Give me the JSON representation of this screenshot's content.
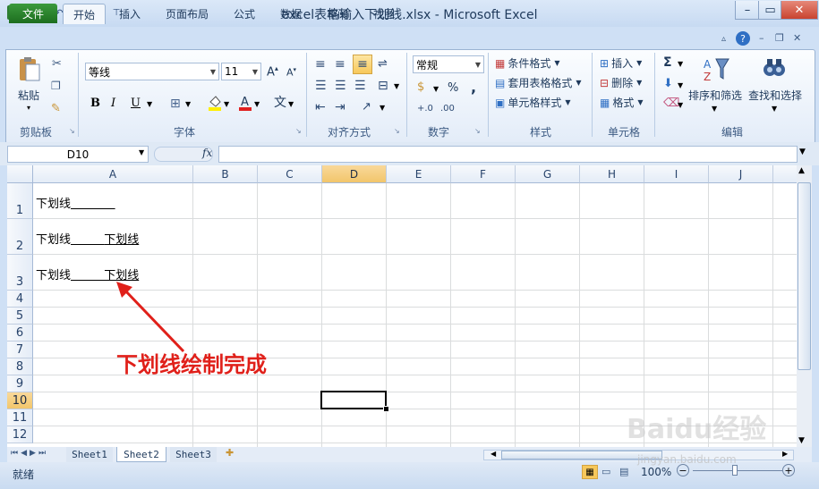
{
  "window": {
    "title": "excel表格输入下划线.xlsx - Microsoft Excel"
  },
  "tabs": [
    "文件",
    "开始",
    "插入",
    "页面布局",
    "公式",
    "数据",
    "审阅",
    "视图"
  ],
  "ribbon": {
    "clipboard": {
      "paste": "粘贴",
      "label": "剪贴板"
    },
    "font": {
      "name": "等线",
      "size": "11",
      "label": "字体",
      "bold": "B",
      "italic": "I",
      "underline": "U"
    },
    "alignment": {
      "label": "对齐方式"
    },
    "number": {
      "format": "常规",
      "label": "数字",
      "percent": "%",
      "comma": ","
    },
    "styles": {
      "conditional": "条件格式",
      "table": "套用表格格式",
      "cell": "单元格样式",
      "label": "样式"
    },
    "cells": {
      "insert": "插入",
      "delete": "删除",
      "format": "格式",
      "label": "单元格"
    },
    "editing": {
      "sort": "排序和筛选",
      "find": "查找和选择",
      "label": "编辑",
      "sum": "Σ"
    }
  },
  "formula_bar": {
    "name_box": "D10",
    "fx": "fx",
    "formula": ""
  },
  "columns": [
    "A",
    "B",
    "C",
    "D",
    "E",
    "F",
    "G",
    "H",
    "I",
    "J"
  ],
  "rows": [
    "1",
    "2",
    "3",
    "4",
    "5",
    "6",
    "7",
    "8",
    "9",
    "10",
    "11",
    "12"
  ],
  "selected_cell": {
    "column": "D",
    "row": "10"
  },
  "cells": {
    "A1_plain": "下划线",
    "A1_under": "            ",
    "A2_plain": "下划线",
    "A2_blank": "         ",
    "A2_under": "下划线",
    "A3_plain": "下划线",
    "A3_under": "         下划线"
  },
  "annotation": "下划线绘制完成",
  "sheets": [
    "Sheet1",
    "Sheet2",
    "Sheet3"
  ],
  "active_sheet": "Sheet2",
  "status": {
    "ready": "就绪",
    "zoom": "100%"
  },
  "watermark": {
    "brand": "Baidu经验",
    "url": "jingyan.baidu.com"
  }
}
